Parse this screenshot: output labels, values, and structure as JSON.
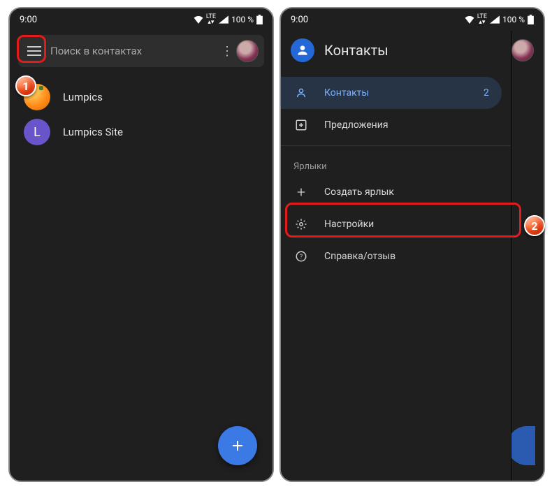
{
  "status": {
    "time": "9:00",
    "battery": "100 %",
    "net_label": "LTE"
  },
  "phone1": {
    "search_placeholder": "Поиск в контактах",
    "contacts": [
      {
        "name": "Lumpics",
        "avatar_style": "orange",
        "initial": ""
      },
      {
        "name": "Lumpics Site",
        "avatar_style": "purple",
        "initial": "L"
      }
    ]
  },
  "phone2": {
    "drawer": {
      "title": "Контакты",
      "selected": {
        "label": "Контакты",
        "count": "2"
      },
      "suggestions": "Предложения",
      "section_labels": "Ярлыки",
      "create_label": "Создать ярлык",
      "settings": "Настройки",
      "help": "Справка/отзыв"
    }
  },
  "callouts": {
    "one": "1",
    "two": "2"
  }
}
